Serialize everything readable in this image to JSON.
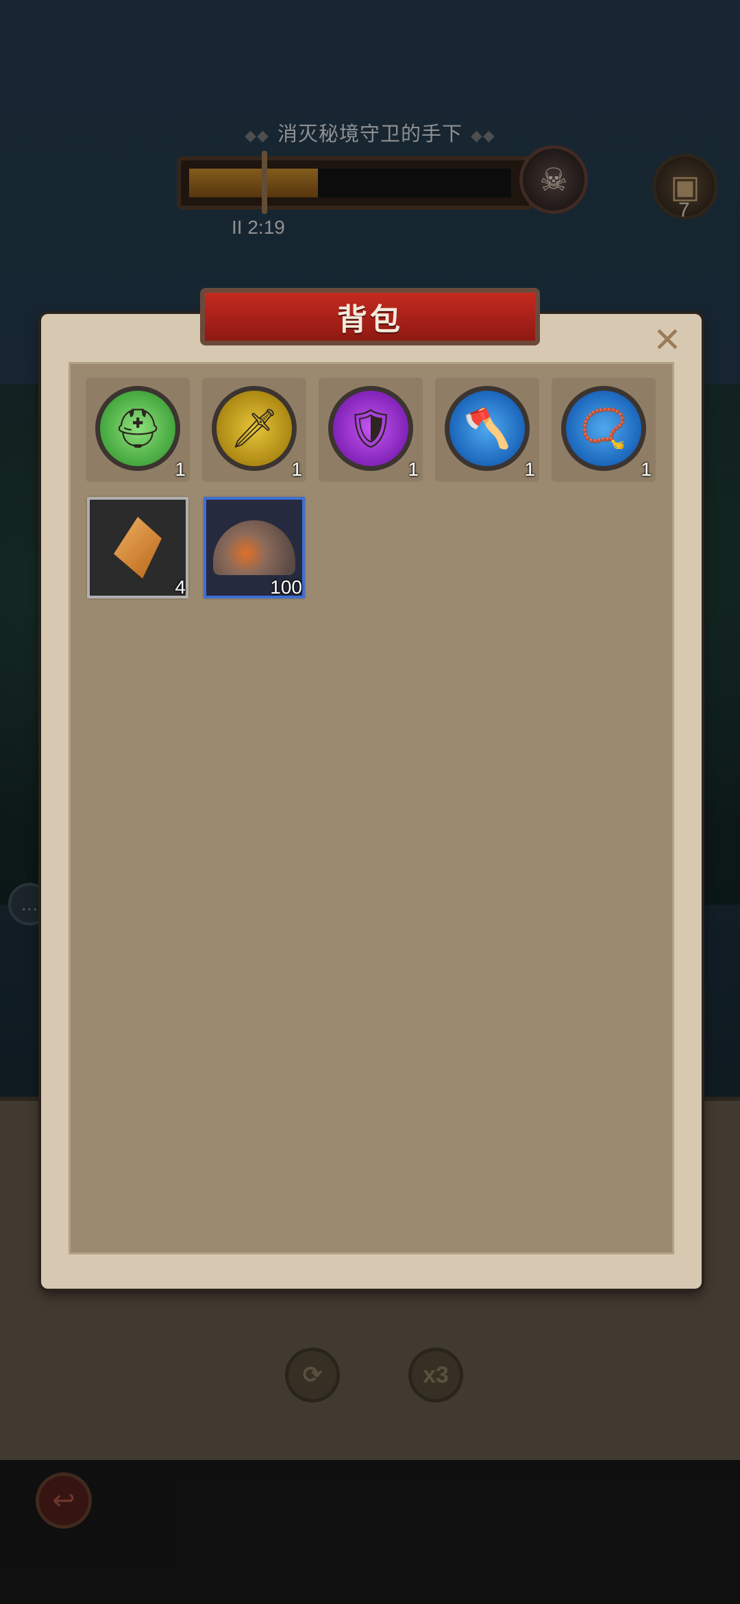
{
  "hud": {
    "quest_title": "消灭秘境守卫的手下",
    "progress": 0.4,
    "timer": "II 2:19",
    "chest_count": "7"
  },
  "panel": {
    "title": "背包",
    "close": "✕"
  },
  "items": [
    {
      "name": "helmet",
      "rarity": "green",
      "icon": "helmet-icon",
      "glyph": "⛑",
      "qty": "1"
    },
    {
      "name": "sword",
      "rarity": "gold",
      "icon": "sword-icon",
      "glyph": "🗡",
      "qty": "1"
    },
    {
      "name": "chest-armor",
      "rarity": "purple",
      "icon": "armor-icon",
      "glyph": "🛡",
      "qty": "1"
    },
    {
      "name": "axe",
      "rarity": "blue",
      "icon": "axe-icon",
      "glyph": "🪓",
      "qty": "1"
    },
    {
      "name": "necklace",
      "rarity": "blue",
      "icon": "necklace-icon",
      "glyph": "📿",
      "qty": "1"
    },
    {
      "name": "crystal-shard",
      "rarity": "gray",
      "icon": "crystal-icon",
      "qty": "4"
    },
    {
      "name": "ore-pile",
      "rarity": "blue",
      "icon": "ore-icon",
      "qty": "100"
    }
  ],
  "bottom": {
    "refresh_icon": "refresh-icon",
    "speed_label": "x3",
    "back_icon": "back-icon"
  },
  "colors": {
    "accent_red": "#c52a20",
    "panel": "#d7c9b1",
    "inner": "#9c8a70"
  }
}
